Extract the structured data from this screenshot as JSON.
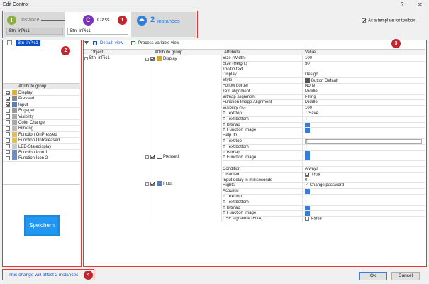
{
  "window": {
    "title": "Edit Control",
    "help": "?",
    "close": "✕"
  },
  "steps": {
    "instance": {
      "letter": "I",
      "label": "Instance",
      "value": "Btn_inPic1"
    },
    "class": {
      "letter": "C",
      "label": "Class",
      "value": "Btn_inPic1"
    },
    "instances": {
      "count": "2",
      "label": "instances"
    }
  },
  "badges": [
    "1",
    "2",
    "3",
    "4"
  ],
  "template_checkbox": {
    "label": "As a template for toolbox",
    "checked": true
  },
  "left": {
    "tree_item": "Btn_inPic1",
    "group_header": "Attribute group",
    "groups": [
      {
        "label": "Display",
        "checked": true,
        "icon": "display-icon"
      },
      {
        "label": "Pressed",
        "checked": true,
        "icon": "pressed-icon"
      },
      {
        "label": "Input",
        "checked": true,
        "icon": "input-icon"
      },
      {
        "label": "Engaged",
        "checked": false,
        "icon": "engaged-icon"
      },
      {
        "label": "Visibility",
        "checked": false,
        "icon": "visibility-icon"
      },
      {
        "label": "Color Change",
        "checked": false,
        "icon": "color-change-icon"
      },
      {
        "label": "Blinking",
        "checked": false,
        "icon": "blinking-icon"
      },
      {
        "label": "Function OnPressed",
        "checked": false,
        "icon": "function-icon"
      },
      {
        "label": "Function OnReleased",
        "checked": false,
        "icon": "function-icon"
      },
      {
        "label": "LED-Statedisplay",
        "checked": false,
        "icon": "led-icon"
      },
      {
        "label": "Function Icon 1",
        "checked": false,
        "icon": "image-icon"
      },
      {
        "label": "Function Icon 2",
        "checked": false,
        "icon": "image-icon"
      }
    ],
    "preview_button": "Speichern"
  },
  "toolbar": {
    "default_view": "Default view",
    "process_view": "Process variable view"
  },
  "grid": {
    "headers": {
      "object": "Object",
      "group": "Attribute group",
      "attribute": "Attribute",
      "value": "Value"
    },
    "object": "Btn_inPic1",
    "group_labels": {
      "display": "Display",
      "pressed": "Pressed",
      "input": "Input"
    },
    "rows": [
      {
        "attr": "Size (Width)",
        "val": "100"
      },
      {
        "attr": "Size (Height)",
        "val": "50"
      },
      {
        "attr": "Tooltip text",
        "val": ""
      },
      {
        "attr": "Display",
        "val": "Design"
      },
      {
        "attr": "Style",
        "val": "Button Default",
        "vi": "style"
      },
      {
        "attr": "Follow border",
        "val": "None"
      },
      {
        "attr": "Text alignment",
        "val": "Middle"
      },
      {
        "attr": "Bitmap alignment",
        "val": "Filling"
      },
      {
        "attr": "Function Image Alignment",
        "val": "Middle"
      },
      {
        "attr": "Visibility (%)",
        "val": "100"
      },
      {
        "attr": "Text top",
        "val": "Save",
        "ai": "text",
        "vi": "text"
      },
      {
        "attr": "Text bottom",
        "val": "",
        "ai": "text",
        "vi": "text"
      },
      {
        "attr": "Bitmap",
        "val": "",
        "ai": "text",
        "vi": "img"
      },
      {
        "attr": "Function Image",
        "val": "",
        "ai": "text",
        "vi": "img"
      },
      {
        "attr": "Help ID",
        "val": ""
      },
      {
        "attr": "Text top",
        "val": "",
        "ai": "text",
        "vi": "text",
        "box": true
      },
      {
        "attr": "Text bottom",
        "val": "",
        "ai": "text",
        "vi": "text"
      },
      {
        "attr": "Bitmap",
        "val": "",
        "ai": "text",
        "vi": "img"
      },
      {
        "attr": "Function Image",
        "val": "",
        "ai": "text",
        "vi": "img"
      },
      {
        "attr": "",
        "val": ""
      },
      {
        "attr": "Condition",
        "val": "Always"
      },
      {
        "attr": "Disabled",
        "val": "True",
        "vi": "check"
      },
      {
        "attr": "Input delay in milliseconds",
        "val": "0"
      },
      {
        "attr": "Rights",
        "val": "Change password",
        "vi": "shield"
      },
      {
        "attr": "Acoustic",
        "val": "",
        "vi": "img"
      },
      {
        "attr": "Text top",
        "val": "",
        "ai": "text",
        "vi": "text"
      },
      {
        "attr": "Text bottom",
        "val": "",
        "ai": "text",
        "vi": "text"
      },
      {
        "attr": "Bitmap",
        "val": "",
        "ai": "text",
        "vi": "img"
      },
      {
        "attr": "Function Image",
        "val": "",
        "ai": "text",
        "vi": "img"
      },
      {
        "attr": "USE signature (FDA)",
        "val": "False",
        "vi": "box"
      }
    ]
  },
  "footer": {
    "message": "This change will affect 2 instances.",
    "ok": "Ok",
    "cancel": "Cancel"
  },
  "colors": {
    "accent_red": "#e53935",
    "badge_red": "#c0262d",
    "instance_green": "#8bb03b",
    "class_purple": "#7b2fbe",
    "instances_blue": "#2f7ed8",
    "selection_blue": "#0a4fc4",
    "link_blue": "#1a55c8"
  }
}
